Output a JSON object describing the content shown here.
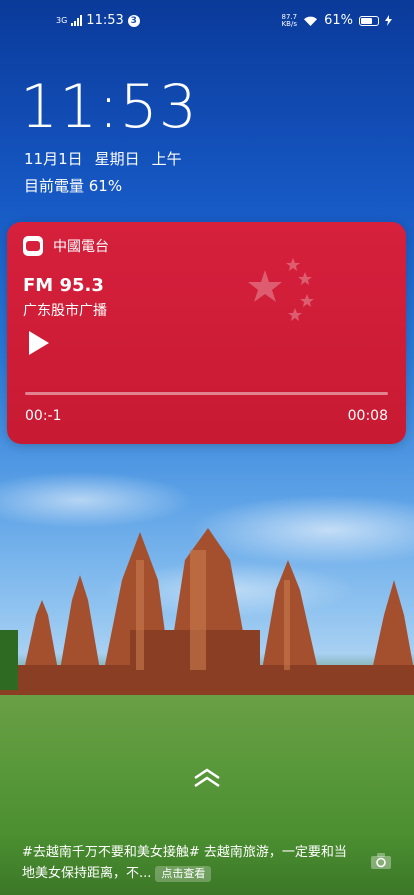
{
  "status_bar": {
    "network": "3G",
    "time": "11:53",
    "notification_count": "3",
    "net_speed_value": "87.7",
    "net_speed_unit": "KB/s",
    "battery_percent": "61%"
  },
  "lockscreen": {
    "clock": "11:53",
    "date": "11月1日",
    "weekday": "星期日",
    "period": "上午",
    "battery_line": "目前電量 61%"
  },
  "media_card": {
    "app_name": "中國電台",
    "frequency": "FM 95.3",
    "station": "广东股市广播",
    "elapsed": "00:-1",
    "duration": "00:08",
    "progress": 0,
    "accent_color": "#d6203c"
  },
  "news": {
    "text": "#去越南千万不要和美女接触# 去越南旅游，一定要和当地美女保持距离，不...",
    "button": "点击查看"
  },
  "icons": [
    "signal-icon",
    "wifi-icon",
    "battery-icon",
    "charging-icon",
    "play-icon",
    "swipe-up-icon",
    "camera-icon",
    "radio-app-icon"
  ]
}
